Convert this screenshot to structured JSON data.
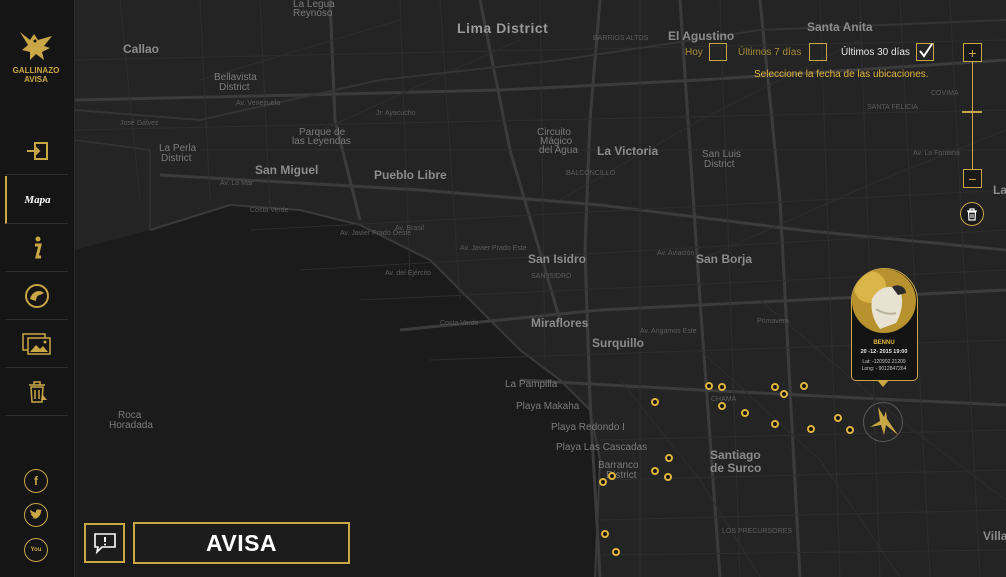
{
  "app": {
    "brand_line1": "GALLINAZO",
    "brand_line2": "AVISA"
  },
  "sidebar": {
    "items": [
      {
        "name": "login",
        "label": "",
        "icon": "login-icon"
      },
      {
        "name": "mapa",
        "label": "Mapa",
        "icon": "map-icon",
        "active": true
      },
      {
        "name": "info",
        "label": "",
        "icon": "info-icon"
      },
      {
        "name": "vulture",
        "label": "",
        "icon": "vulture-head-icon"
      },
      {
        "name": "gallery",
        "label": "",
        "icon": "gallery-icon"
      },
      {
        "name": "trash-report",
        "label": "",
        "icon": "trash-report-icon"
      }
    ],
    "social": [
      {
        "name": "facebook",
        "glyph": "f"
      },
      {
        "name": "twitter",
        "glyph": "t"
      },
      {
        "name": "youtube",
        "glyph": "You"
      }
    ]
  },
  "filters": {
    "today": {
      "label": "Hoy",
      "checked": false
    },
    "last7": {
      "label": "Últimos 7 días",
      "checked": false
    },
    "last30": {
      "label": "Últimos 30 días",
      "checked": true
    },
    "hint": "Seleccione la fecha de las ubicaciones."
  },
  "zoom": {
    "in_label": "+",
    "out_label": "−",
    "level": 0.5
  },
  "popup": {
    "name": "BENNU",
    "date": "20 -12- 2015 19:00",
    "lat": "Lat: -120902.21209",
    "long": "Long: - 9012847264"
  },
  "avisa": {
    "label": "AVISA"
  },
  "colors": {
    "accent": "#c9a646",
    "accent_bright": "#e0b63d",
    "sidebar_bg": "#151515",
    "map_bg": "#242424"
  },
  "map": {
    "labels": [
      {
        "id": "lima-district",
        "text": "Lima District",
        "cls": "lbl-xl"
      },
      {
        "id": "callao",
        "text": "Callao",
        "cls": "lbl-lg"
      },
      {
        "id": "el-agustino",
        "text": "El Agustino",
        "cls": "lbl-lg"
      },
      {
        "id": "santa-anita",
        "text": "Santa Anita",
        "cls": "lbl-lg"
      },
      {
        "id": "san-miguel",
        "text": "San Miguel",
        "cls": "lbl-lg"
      },
      {
        "id": "pueblo-libre",
        "text": "Pueblo Libre",
        "cls": "lbl-lg"
      },
      {
        "id": "la-victoria",
        "text": "La Victoria",
        "cls": "lbl-lg"
      },
      {
        "id": "san-isidro",
        "text": "San Isidro",
        "cls": "lbl-lg"
      },
      {
        "id": "san-borja",
        "text": "San Borja",
        "cls": "lbl-lg"
      },
      {
        "id": "miraflores",
        "text": "Miraflores",
        "cls": "lbl-lg"
      },
      {
        "id": "surquillo",
        "text": "Surquillo",
        "cls": "lbl-lg"
      },
      {
        "id": "santiago-de-surco-1",
        "text": "Santiago",
        "cls": "lbl-lg"
      },
      {
        "id": "santiago-de-surco-2",
        "text": "de Surco",
        "cls": "lbl-lg"
      },
      {
        "id": "bellavista",
        "text": "Bellavista",
        "cls": "lbl-md"
      },
      {
        "id": "bellavista-district",
        "text": "District",
        "cls": "lbl-md"
      },
      {
        "id": "la-perla",
        "text": "La Perla",
        "cls": "lbl-md"
      },
      {
        "id": "la-perla-district",
        "text": "District",
        "cls": "lbl-md"
      },
      {
        "id": "san-luis",
        "text": "San Luis",
        "cls": "lbl-md"
      },
      {
        "id": "san-luis-district",
        "text": "District",
        "cls": "lbl-md"
      },
      {
        "id": "barranco",
        "text": "Barranco",
        "cls": "lbl-md"
      },
      {
        "id": "barranco-district",
        "text": "District",
        "cls": "lbl-md"
      },
      {
        "id": "la-legua",
        "text": "La Legua",
        "cls": "lbl-md"
      },
      {
        "id": "reynoso",
        "text": "Reynoso",
        "cls": "lbl-md"
      },
      {
        "id": "roca-horadada-1",
        "text": "Roca",
        "cls": "lbl-md"
      },
      {
        "id": "roca-horadada-2",
        "text": "Horadada",
        "cls": "lbl-md"
      },
      {
        "id": "la-pampilla",
        "text": "La Pampilla",
        "cls": "lbl-md"
      },
      {
        "id": "playa-makaha",
        "text": "Playa Makaha",
        "cls": "lbl-md"
      },
      {
        "id": "playa-redondo",
        "text": "Playa Redondo I",
        "cls": "lbl-md"
      },
      {
        "id": "playa-las-cascadas",
        "text": "Playa Las Cascadas",
        "cls": "lbl-md"
      },
      {
        "id": "la",
        "text": "La",
        "cls": "lbl-lg"
      },
      {
        "id": "villa",
        "text": "Villa",
        "cls": "lbl-lg"
      },
      {
        "id": "parque-leyendas-1",
        "text": "Parque de",
        "cls": "lbl-md"
      },
      {
        "id": "parque-leyendas-2",
        "text": "las Leyendas",
        "cls": "lbl-md"
      },
      {
        "id": "circuito-1",
        "text": "Circuito",
        "cls": "lbl-md"
      },
      {
        "id": "circuito-2",
        "text": "Mágico",
        "cls": "lbl-md"
      },
      {
        "id": "circuito-3",
        "text": "del Agua",
        "cls": "lbl-md"
      },
      {
        "id": "chama",
        "text": "CHAMA",
        "cls": "lbl-sm"
      },
      {
        "id": "barrios-altos",
        "text": "BARRIOS ALTOS",
        "cls": "lbl-sm"
      },
      {
        "id": "santa-felicia",
        "text": "SANTA FELICIA",
        "cls": "lbl-sm"
      },
      {
        "id": "covima",
        "text": "COVIMA",
        "cls": "lbl-sm"
      },
      {
        "id": "balconcillo",
        "text": "BALCONCILLO",
        "cls": "lbl-sm"
      },
      {
        "id": "los-precursores",
        "text": "LOS PRECURSORES",
        "cls": "lbl-sm"
      },
      {
        "id": "san-isidro-sm",
        "text": "SAN ISIDRO",
        "cls": "lbl-sm"
      },
      {
        "id": "costa-verde",
        "text": "Costa Verde",
        "cls": "lbl-sm"
      },
      {
        "id": "av-venezuela",
        "text": "Av. Venezuela",
        "cls": "lbl-sm"
      },
      {
        "id": "av-brasil",
        "text": "Av. Brasil",
        "cls": "lbl-sm"
      },
      {
        "id": "av-javier-prado",
        "text": "Av. Javier Prado Este",
        "cls": "lbl-sm"
      },
      {
        "id": "av-angamos",
        "text": "Av. Angamos Este",
        "cls": "lbl-sm"
      },
      {
        "id": "av-aviacion",
        "text": "Av. Aviación",
        "cls": "lbl-sm"
      },
      {
        "id": "av-primavera",
        "text": "Primavera",
        "cls": "lbl-sm"
      },
      {
        "id": "av-la-fontana",
        "text": "Av. La Fontana",
        "cls": "lbl-sm"
      },
      {
        "id": "jose-galvez",
        "text": "José Gálvez",
        "cls": "lbl-sm"
      },
      {
        "id": "av-del-ejercito",
        "text": "Av. del Ejército",
        "cls": "lbl-sm"
      },
      {
        "id": "av-la-mar",
        "text": "Av. La Mar",
        "cls": "lbl-sm"
      },
      {
        "id": "jr-ayacucho",
        "text": "Jr. Ayacucho",
        "cls": "lbl-sm"
      },
      {
        "id": "javier-prado-oeste",
        "text": "Av. Javier Prado Oeste",
        "cls": "lbl-sm"
      },
      {
        "id": "costa-verde-2",
        "text": "Costa Verde",
        "cls": "lbl-sm"
      }
    ],
    "points": [
      {
        "id": "p1"
      },
      {
        "id": "p2"
      },
      {
        "id": "p3"
      },
      {
        "id": "p4"
      },
      {
        "id": "p5"
      },
      {
        "id": "p6"
      },
      {
        "id": "p7"
      },
      {
        "id": "p8"
      },
      {
        "id": "p9"
      },
      {
        "id": "p10"
      },
      {
        "id": "p11"
      },
      {
        "id": "p12"
      },
      {
        "id": "p13"
      },
      {
        "id": "p14"
      },
      {
        "id": "p15"
      },
      {
        "id": "p16"
      },
      {
        "id": "p17"
      },
      {
        "id": "p18"
      },
      {
        "id": "p19"
      }
    ]
  }
}
